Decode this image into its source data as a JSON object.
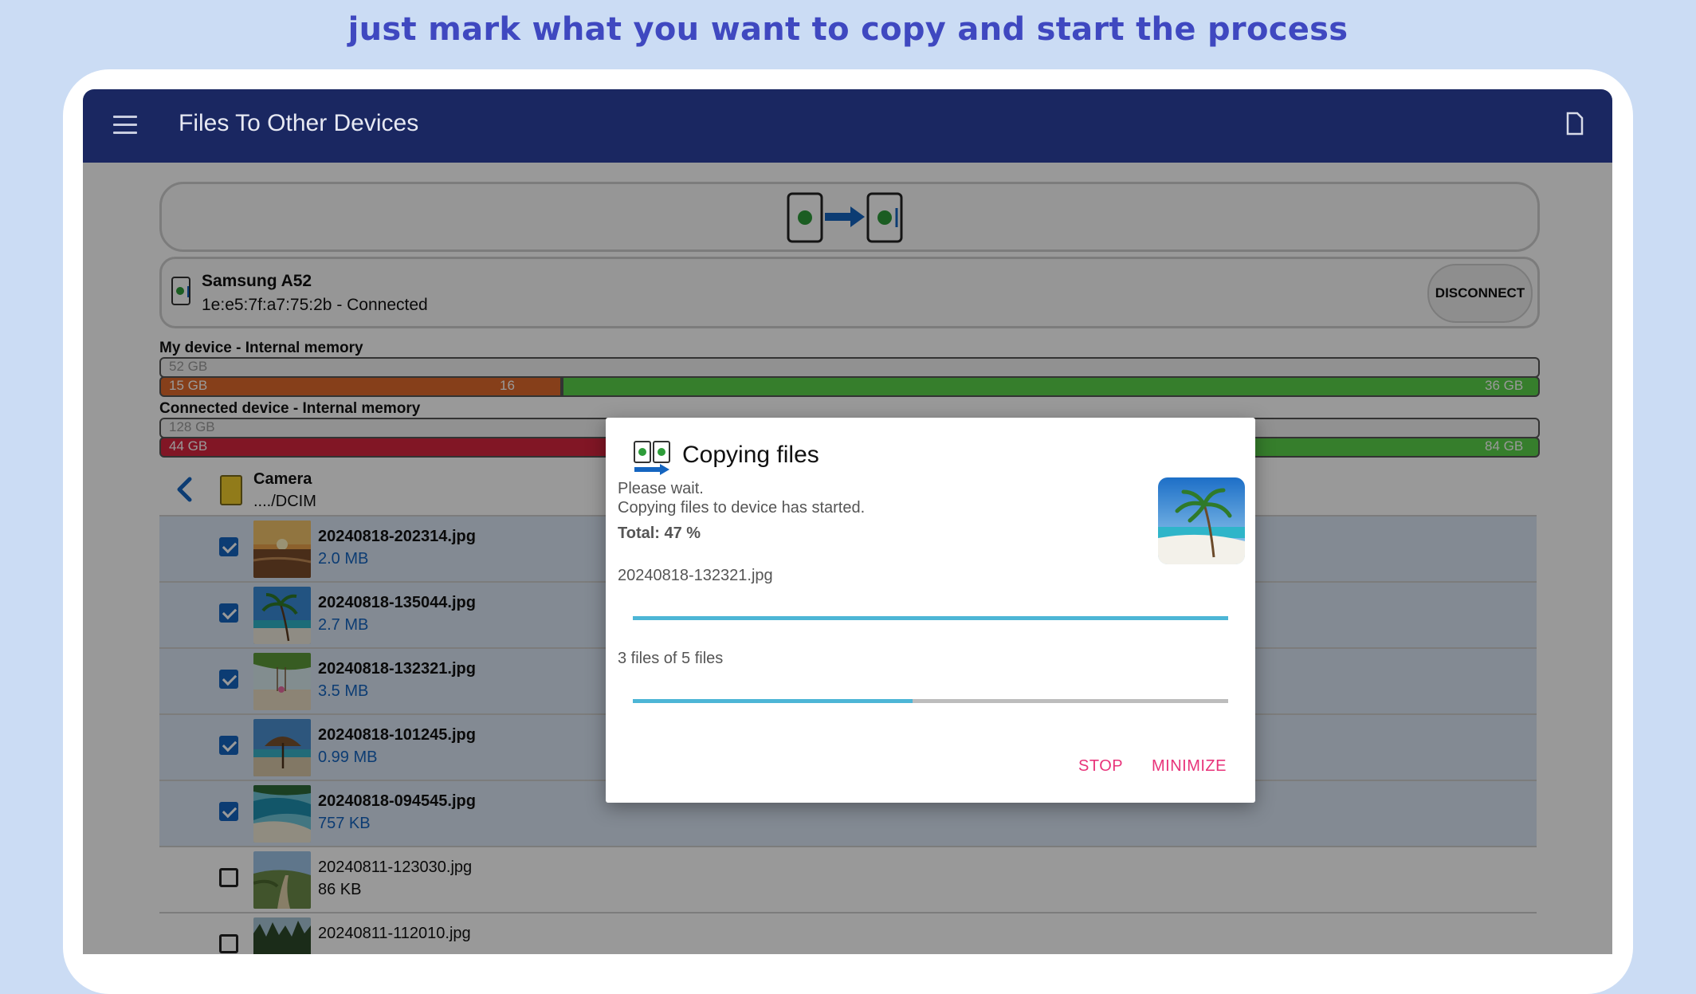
{
  "caption": "just mark what you want to copy and start the process",
  "appbar": {
    "title": "Files To Other Devices"
  },
  "device": {
    "name": "Samsung A52",
    "status": "1e:e5:7f:a7:75:2b - Connected",
    "disconnect_label": "DISCONNECT"
  },
  "memory": {
    "my_label": "My device - Internal memory",
    "my_total": "52 GB",
    "my_used": "15 GB",
    "my_used_fraction": 0.29,
    "my_free_partial": "16",
    "my_free": "36 GB",
    "conn_label": "Connected device - Internal memory",
    "conn_total": "128 GB",
    "conn_used": "44 GB",
    "conn_used_fraction": 0.34,
    "conn_free": "84 GB"
  },
  "folder": {
    "name": "Camera",
    "path": "..../DCIM"
  },
  "files": [
    {
      "name": "20240818-202314.jpg",
      "size": "2.0 MB",
      "checked": true,
      "thumb": "sunset-beach"
    },
    {
      "name": "20240818-135044.jpg",
      "size": "2.7 MB",
      "checked": true,
      "thumb": "palm-beach"
    },
    {
      "name": "20240818-132321.jpg",
      "size": "3.5 MB",
      "checked": true,
      "thumb": "beach-swing"
    },
    {
      "name": "20240818-101245.jpg",
      "size": "0.99 MB",
      "checked": true,
      "thumb": "beach-umbrella"
    },
    {
      "name": "20240818-094545.jpg",
      "size": "757 KB",
      "checked": true,
      "thumb": "lagoon"
    },
    {
      "name": "20240811-123030.jpg",
      "size": "86 KB",
      "checked": false,
      "thumb": "dune-path"
    },
    {
      "name": "20240811-112010.jpg",
      "size": "",
      "checked": false,
      "thumb": "forest"
    }
  ],
  "dialog": {
    "title": "Copying files",
    "line1": "Please wait.",
    "line2": "Copying files to device has started.",
    "total": "Total: 47 %",
    "current_file": "20240818-132321.jpg",
    "file_progress": 1.0,
    "count_text": "3 files of 5 files",
    "overall_progress": 0.47,
    "stop_label": "STOP",
    "minimize_label": "MINIMIZE"
  },
  "colors": {
    "accent": "#e8337a",
    "appbar": "#1a2761",
    "progress": "#4db6d6",
    "selected_row": "#dbe7f5"
  }
}
